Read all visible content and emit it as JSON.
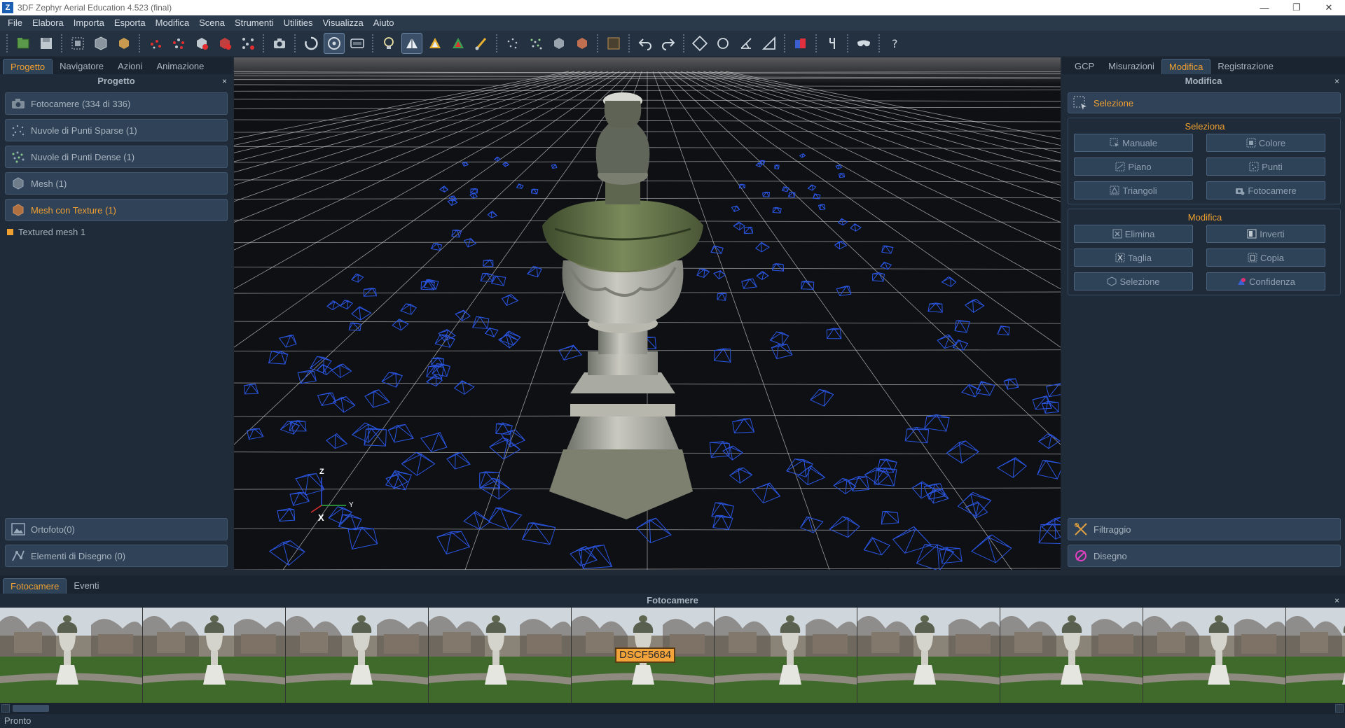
{
  "window": {
    "app_letter": "Z",
    "title": "3DF Zephyr Aerial Education 4.523 (final)",
    "minimize": "—",
    "maximize": "❐",
    "close": "✕"
  },
  "menu": [
    "File",
    "Elabora",
    "Importa",
    "Esporta",
    "Modifica",
    "Scena",
    "Strumenti",
    "Utilities",
    "Visualizza",
    "Aiuto"
  ],
  "left_panel": {
    "tabs": [
      "Progetto",
      "Navigatore",
      "Azioni",
      "Animazione"
    ],
    "header": "Progetto",
    "close": "×",
    "entries": [
      {
        "label": "Fotocamere (334 di 336)",
        "icon": "camera-icon"
      },
      {
        "label": "Nuvole di Punti Sparse (1)",
        "icon": "sparse-cloud-icon"
      },
      {
        "label": "Nuvole di Punti Dense (1)",
        "icon": "dense-cloud-icon"
      },
      {
        "label": "Mesh (1)",
        "icon": "mesh-icon"
      },
      {
        "label": "Mesh con Texture (1)",
        "icon": "textured-mesh-icon"
      }
    ],
    "sub_item": "Textured mesh 1",
    "bottom_entries": [
      {
        "label": "Ortofoto(0)",
        "icon": "orthophoto-icon"
      },
      {
        "label": "Elementi di Disegno (0)",
        "icon": "drawing-elements-icon"
      }
    ]
  },
  "viewport": {
    "axis_z": "Z",
    "axis_y": "Y",
    "axis_x": "X"
  },
  "right_panel": {
    "tabs": [
      "GCP",
      "Misurazioni",
      "Modifica",
      "Registrazione"
    ],
    "header": "Modifica",
    "close": "×",
    "selection_label": "Selezione",
    "group_select": {
      "title": "Seleziona",
      "buttons": [
        "Manuale",
        "Colore",
        "Piano",
        "Punti",
        "Triangoli",
        "Fotocamere"
      ]
    },
    "group_edit": {
      "title": "Modifica",
      "buttons": [
        "Elimina",
        "Inverti",
        "Taglia",
        "Copia",
        "Selezione",
        "Confidenza"
      ]
    },
    "bottom_entries": [
      {
        "label": "Filtraggio",
        "icon": "filter-icon"
      },
      {
        "label": "Disegno",
        "icon": "drawing-icon"
      }
    ]
  },
  "bottom": {
    "tabs": [
      "Fotocamere",
      "Eventi"
    ],
    "header": "Fotocamere",
    "close": "×",
    "hover_label": "DSCF5684"
  },
  "status": "Pronto",
  "colors": {
    "accent": "#f0a030",
    "camera_frustum": "#2a55e0",
    "panel_bg": "#1f2b38"
  }
}
